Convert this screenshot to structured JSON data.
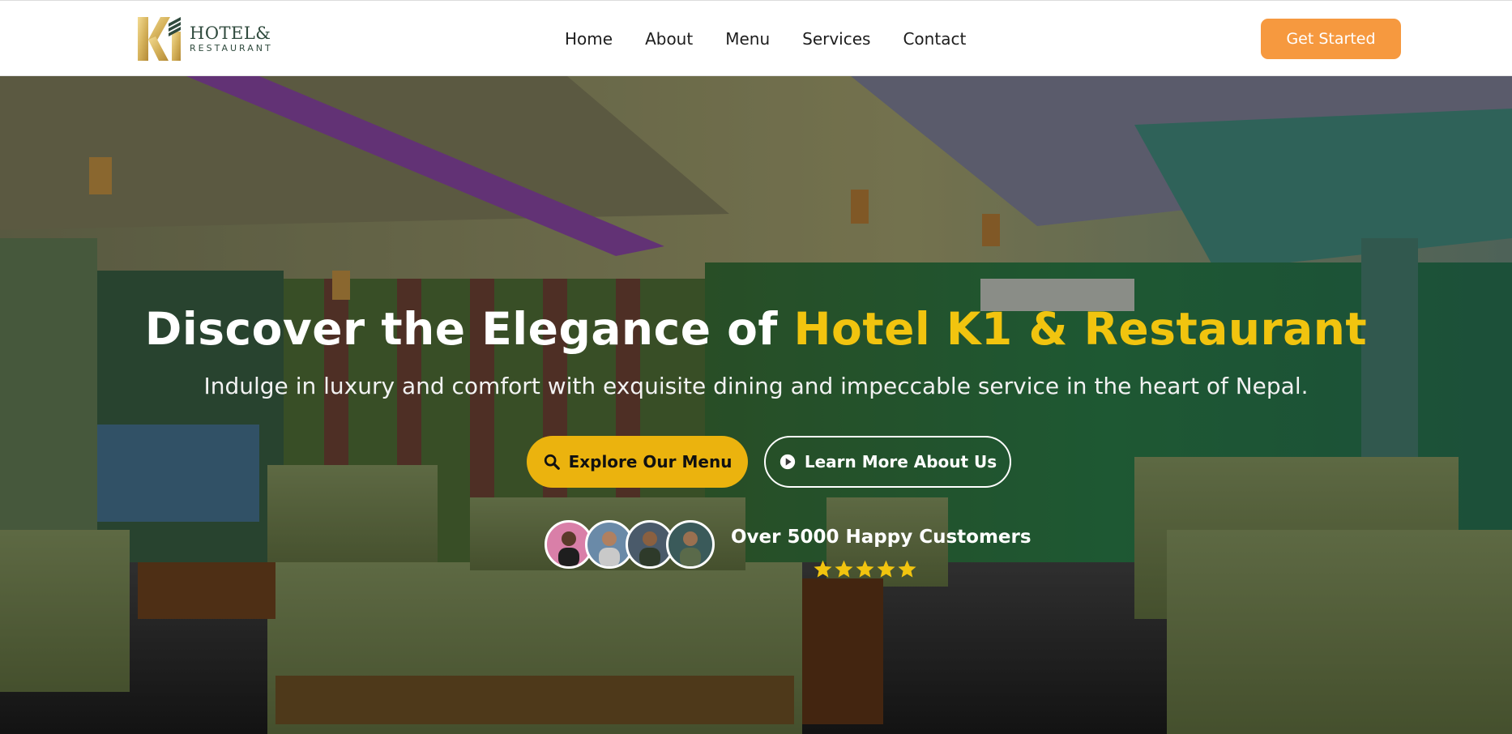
{
  "brand": {
    "logo_line1": "HOTEL&",
    "logo_line2": "RESTAURANT",
    "gold": "#d6b35c",
    "green": "#2f4a3d"
  },
  "nav": {
    "items": [
      "Home",
      "About",
      "Menu",
      "Services",
      "Contact"
    ]
  },
  "header": {
    "cta_label": "Get Started",
    "cta_color": "#f6993f"
  },
  "hero": {
    "title_plain": "Discover the Elegance of ",
    "title_highlight": "Hotel K1 & Restaurant",
    "highlight_color": "#f1c40f",
    "subtitle": "Indulge in luxury and comfort with exquisite dining and impeccable service in the heart of Nepal.",
    "primary_button": {
      "label": "Explore Our Menu",
      "icon": "search-icon",
      "color": "#ebb30e"
    },
    "secondary_button": {
      "label": "Learn More About Us",
      "icon": "play-circle-icon"
    },
    "social_proof": {
      "text": "Over 5000 Happy Customers",
      "rating": 5,
      "rating_max": 5
    }
  }
}
